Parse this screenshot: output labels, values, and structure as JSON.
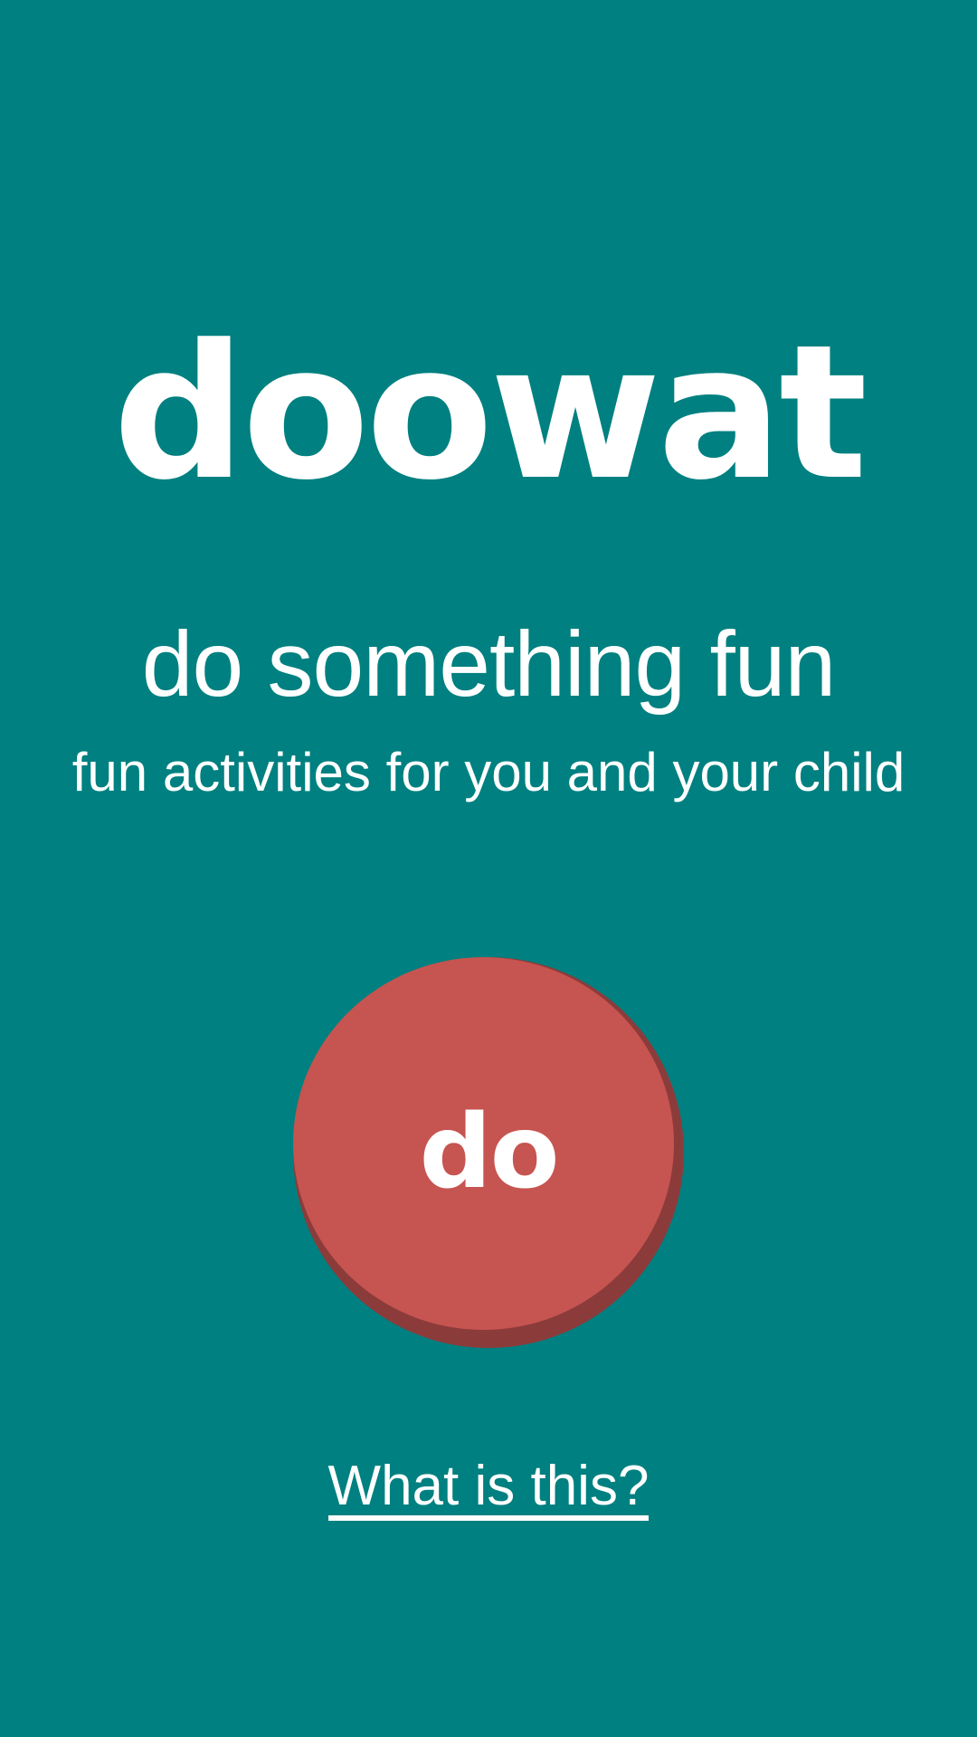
{
  "app": {
    "logo": "doowat",
    "tagline": "do something fun",
    "subtitle": "fun activities for you and your child"
  },
  "do_button": {
    "label": "do"
  },
  "link": {
    "label": "What is this?"
  },
  "colors": {
    "background": "#008080",
    "button_face": "#c65450",
    "button_shadow": "#8c3b3b",
    "text": "#ffffff"
  }
}
